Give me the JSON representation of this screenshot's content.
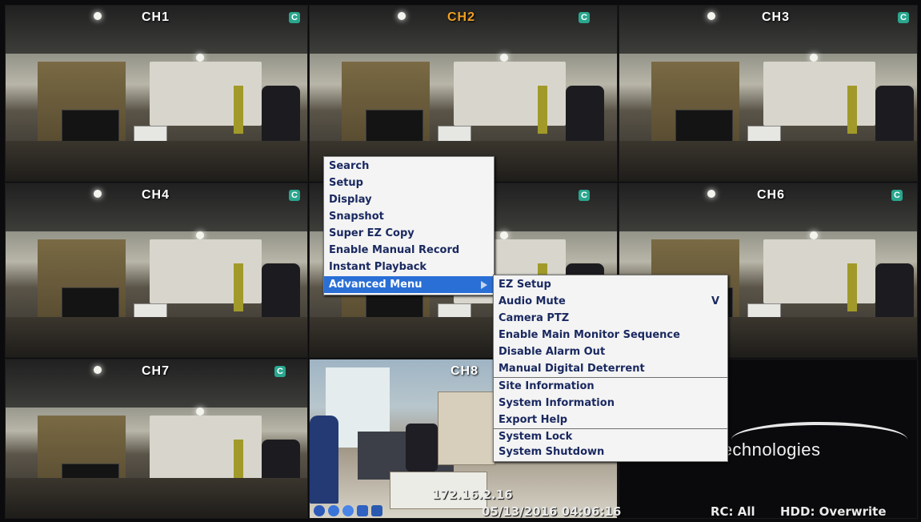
{
  "channels": [
    {
      "label": "CH1",
      "badge": "C"
    },
    {
      "label": "CH2",
      "badge": "C"
    },
    {
      "label": "CH3",
      "badge": "C"
    },
    {
      "label": "CH4",
      "badge": "C"
    },
    {
      "label": "CH6",
      "badge": "C"
    },
    {
      "label": "CH7",
      "badge": "C"
    },
    {
      "label": "CH8"
    }
  ],
  "hidden_tile_badge": "C",
  "main_menu": {
    "items": [
      "Search",
      "Setup",
      "Display",
      "Snapshot",
      "Super EZ Copy",
      "Enable Manual Record",
      "Instant Playback",
      "Advanced Menu"
    ],
    "selected": "Advanced Menu"
  },
  "advanced_menu": {
    "group1": [
      "EZ Setup",
      "Audio Mute",
      "Camera PTZ",
      "Enable Main Monitor Sequence",
      "Disable Alarm Out",
      "Manual Digital Deterrent"
    ],
    "group2": [
      "Site Information",
      "System Information",
      "Export Help"
    ],
    "group3": [
      "System Lock",
      "System Shutdown"
    ],
    "audio_mute_mark": "V"
  },
  "logo": {
    "text": "technologies"
  },
  "status_bar": {
    "ip": "172.16.2.16",
    "datetime": "05/13/2016 04:06:16",
    "rc": "RC: All",
    "hdd": "HDD: Overwrite"
  },
  "colors": {
    "menu_highlight": "#2a6fd6",
    "menu_text": "#1a2960",
    "active_channel": "#f0a020",
    "badge": "#2aa68e"
  }
}
